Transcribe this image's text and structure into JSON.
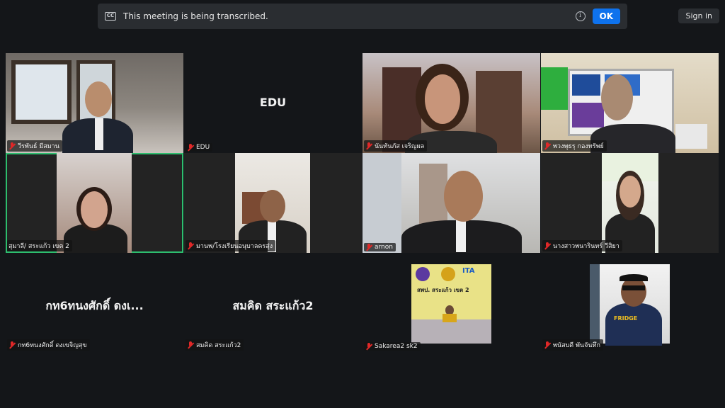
{
  "banner": {
    "text": "This meeting is being transcribed.",
    "cc_icon": "cc-icon",
    "info_icon": "info-icon",
    "ok_label": "OK"
  },
  "signin_label": "Sign in",
  "tiles": [
    {
      "name": "วีรพันธ์ มีสมาน"
    },
    {
      "name": "EDU",
      "display": "EDU"
    },
    {
      "name": "นันทันภัส เจริญผล"
    },
    {
      "name": "พวงพุธรุ กองทรัพย์"
    },
    {
      "name": "สุมาลี/ สระแก้ว เขต 2"
    },
    {
      "name": "มานพ/โรงเรียนอนุบาลครสุ่ง"
    },
    {
      "name": "arnon"
    },
    {
      "name": "นางสาวพนารินทร์ วีสิยา"
    },
    {
      "name": "กท6ทนงศักดิ์ ดงเขจิญสุข",
      "display": "กท6ทนงศักดิ์ ดงเ..."
    },
    {
      "name": "สมคิด สระแก้ว2",
      "display": "สมคิด สระแก้ว2"
    },
    {
      "name": "Sakarea2 sk2"
    },
    {
      "name": "พนัสบดี พันจันทึก"
    }
  ],
  "sign_text": "สพป. สระแก้ว เขต 2",
  "itx_text": "ITA",
  "shirt_text": "FRIDGE",
  "colors": {
    "active_border": "#2dbd6e",
    "ok_blue": "#0e72ed",
    "mic_muted": "#e02828"
  }
}
